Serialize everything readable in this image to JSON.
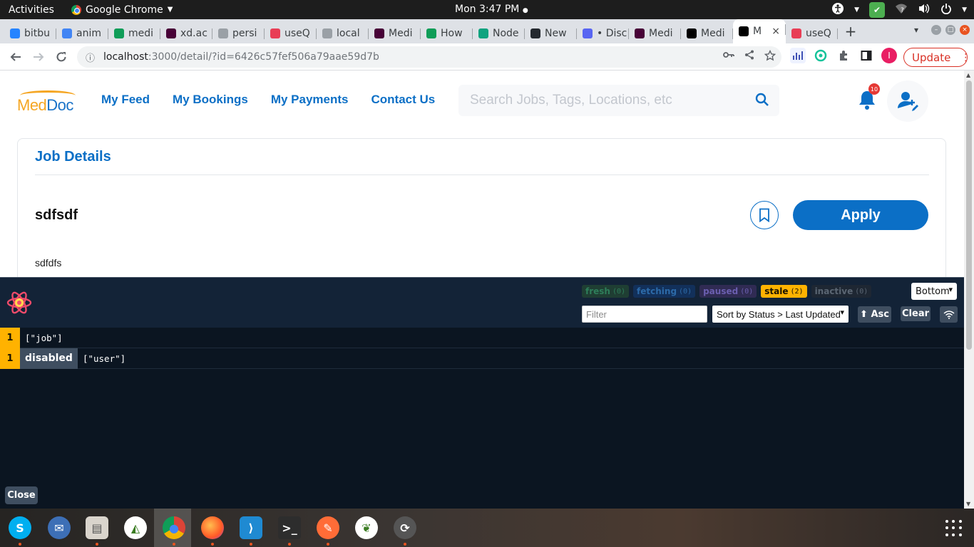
{
  "system": {
    "activities": "Activities",
    "app_name": "Google Chrome",
    "clock": "Mon  3:47 PM"
  },
  "browser": {
    "tabs": [
      {
        "label": "bitbu",
        "icon": "bitbucket-icon",
        "color": "#2684ff"
      },
      {
        "label": "anim",
        "icon": "google-icon",
        "color": "#4285f4"
      },
      {
        "label": "medi",
        "icon": "sheets-icon",
        "color": "#0f9d58"
      },
      {
        "label": "xd.ac",
        "icon": "xd-icon",
        "color": "#470137"
      },
      {
        "label": "persi",
        "icon": "globe-icon",
        "color": "#9aa0a6"
      },
      {
        "label": "useQ",
        "icon": "tanstack-icon",
        "color": "#e83e56"
      },
      {
        "label": "local",
        "icon": "globe-icon",
        "color": "#9aa0a6"
      },
      {
        "label": "Medi",
        "icon": "xd-icon",
        "color": "#470137"
      },
      {
        "label": "How",
        "icon": "link-icon",
        "color": "#0f9d58"
      },
      {
        "label": "Node",
        "icon": "chatgpt-icon",
        "color": "#10a37f"
      },
      {
        "label": "New",
        "icon": "github-icon",
        "color": "#24292f"
      },
      {
        "label": "• Disc",
        "icon": "discord-icon",
        "color": "#5865f2"
      },
      {
        "label": "Medi",
        "icon": "xd-icon",
        "color": "#470137"
      },
      {
        "label": "Medi",
        "icon": "nextjs-icon",
        "color": "#000000"
      },
      {
        "label": "M",
        "icon": "nextjs-icon",
        "color": "#000000",
        "active": true
      },
      {
        "label": "useQ",
        "icon": "tanstack-icon",
        "color": "#e83e56"
      }
    ],
    "url_host": "localhost",
    "url_path": ":3000/detail/?id=6426c57fef506a79aae59d7b",
    "update_label": "Update",
    "profile_initial": "I"
  },
  "app": {
    "logo_med": "Med",
    "logo_doc": "Doc",
    "nav": [
      "My Feed",
      "My Bookings",
      "My Payments",
      "Contact Us"
    ],
    "search_placeholder": "Search Jobs, Tags, Locations, etc",
    "notification_count": "10",
    "brand_color": "#0b6fc6"
  },
  "job": {
    "section_title": "Job Details",
    "title": "sdfsdf",
    "description": "sdfdfs",
    "apply_label": "Apply"
  },
  "devtools": {
    "badges": [
      {
        "label": "fresh",
        "count": "(0)",
        "cls": "b-fresh"
      },
      {
        "label": "fetching",
        "count": "(0)",
        "cls": "b-fetching"
      },
      {
        "label": "paused",
        "count": "(0)",
        "cls": "b-paused"
      },
      {
        "label": "stale",
        "count": "(2)",
        "cls": "b-stale"
      },
      {
        "label": "inactive",
        "count": "(0)",
        "cls": "b-inactive"
      }
    ],
    "position": "Bottom",
    "filter_placeholder": "Filter",
    "sort": "Sort by Status > Last Updated",
    "asc_label": "⬆ Asc",
    "clear_label": "Clear",
    "queries": [
      {
        "count": "1",
        "disabled": "",
        "key": "[\"job\"]"
      },
      {
        "count": "1",
        "disabled": "disabled",
        "key": "[\"user\"]"
      }
    ],
    "close_label": "Close"
  },
  "dock": [
    "skype-icon",
    "mail-icon",
    "files-icon",
    "android-studio-icon",
    "chrome-icon",
    "firefox-icon",
    "vscode-icon",
    "terminal-icon",
    "postman-icon",
    "mongodb-icon",
    "updater-icon"
  ]
}
